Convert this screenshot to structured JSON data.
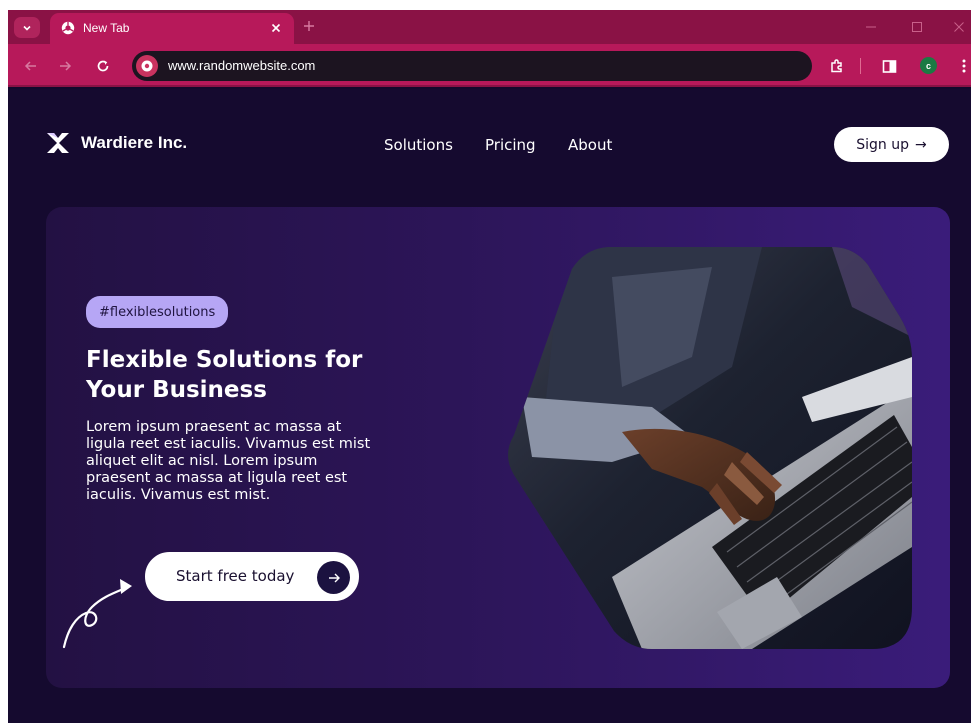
{
  "browser": {
    "tab_title": "New Tab",
    "url": "www.randomwebsite.com",
    "profile_initial": "c",
    "accent": "#b7195a"
  },
  "nav": {
    "brand": "Wardiere Inc.",
    "links": [
      "Solutions",
      "Pricing",
      "About"
    ],
    "signup_label": "Sign up",
    "signup_arrow": "→"
  },
  "hero": {
    "tag": "#flexiblesolutions",
    "headline": "Flexible Solutions for\nYour Business",
    "body": "Lorem ipsum praesent ac massa at\nligula reet est iaculis. Vivamus est mist\naliquet elit ac nisl. Lorem ipsum\npraesent ac massa at ligula reet est\niaculis. Vivamus est mist.",
    "cta_label": "Start free today",
    "cta_arrow": "→",
    "image_icon": "laptop-typing-photo",
    "background": "#2c1558",
    "tag_color": "#b6a6f5"
  }
}
